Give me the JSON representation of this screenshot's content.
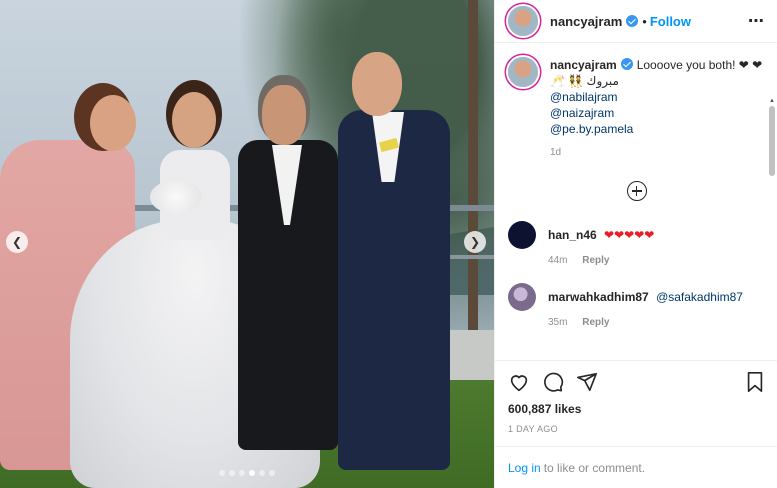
{
  "post": {
    "photo": {
      "alt_subject": "Group photo of four people at a wedding outdoors",
      "carousel_dots": 6,
      "active_dot": 3
    },
    "header": {
      "username": "nancyajram",
      "separator": "•",
      "follow_label": "Follow",
      "more_icon": "more-options-icon"
    },
    "caption": {
      "username": "nancyajram",
      "text": "Loooove you both! ❤ ❤",
      "arabic": "مبروك 👯 🥂",
      "mentions": [
        "@nabilajram",
        "@naizajram",
        "@pe.by.pamela"
      ],
      "age": "1d"
    },
    "comments": [
      {
        "user": "han_n46",
        "text": "❤❤❤❤❤",
        "age": "44m",
        "reply_label": "Reply"
      },
      {
        "user": "marwahkadhim87",
        "text": "@safakadhim87",
        "age": "35m",
        "reply_label": "Reply"
      }
    ],
    "stats": {
      "likes": "600,887 likes",
      "time": "1 DAY AGO"
    },
    "login": {
      "link": "Log in",
      "rest": "to like or comment."
    }
  }
}
